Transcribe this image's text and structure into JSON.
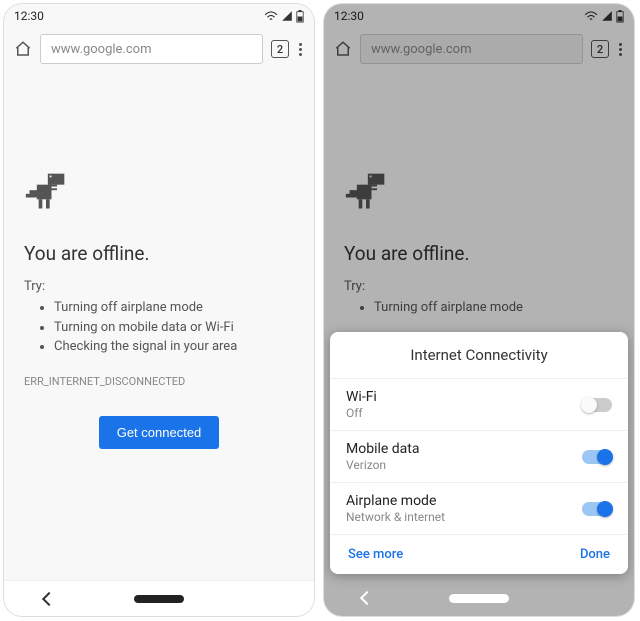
{
  "status": {
    "time": "12:30",
    "tab_count": "2"
  },
  "omnibox": {
    "url": "www.google.com"
  },
  "offline": {
    "headline": "You are offline.",
    "try_label": "Try:",
    "suggestions": [
      "Turning off airplane mode",
      "Turning on mobile data or Wi-Fi",
      "Checking the signal in your area"
    ],
    "error_code": "ERR_INTERNET_DISCONNECTED",
    "cta": "Get connected"
  },
  "sheet": {
    "title": "Internet Connectivity",
    "rows": [
      {
        "label": "Wi-Fi",
        "sub": "Off",
        "on": false
      },
      {
        "label": "Mobile data",
        "sub": "Verizon",
        "on": true
      },
      {
        "label": "Airplane mode",
        "sub": "Network & internet",
        "on": true
      }
    ],
    "see_more": "See more",
    "done": "Done"
  }
}
